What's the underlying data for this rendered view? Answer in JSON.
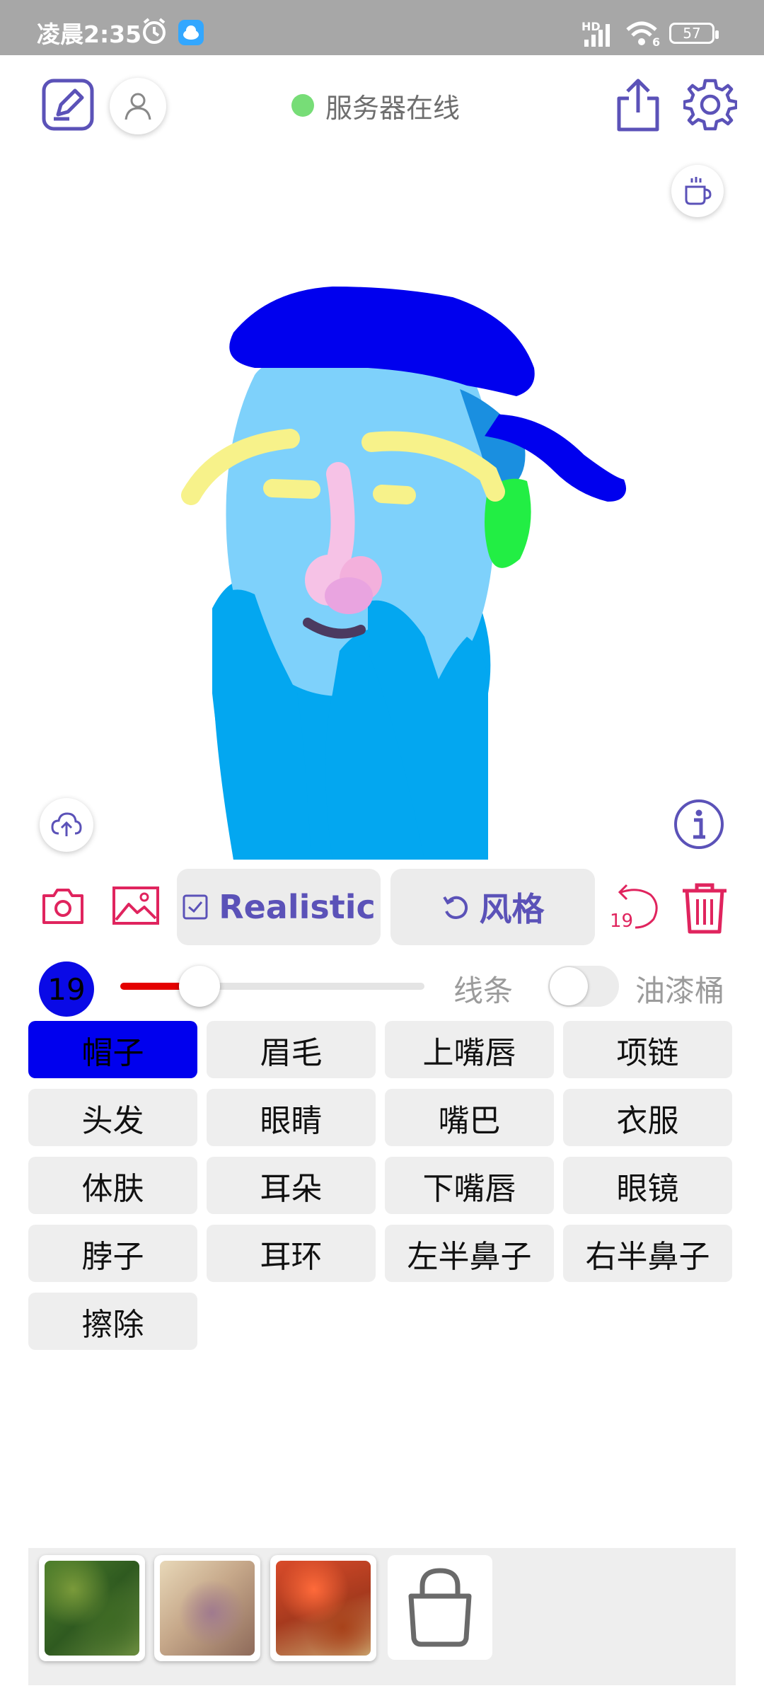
{
  "status_bar": {
    "time": "凌晨2:35",
    "network_label": "HD",
    "signal_sub": "6",
    "battery": "57"
  },
  "header": {
    "server_status": "服务器在线",
    "server_status_color": "#77dd77"
  },
  "toolbar": {
    "style_mode_label": "Realistic",
    "style_button_label": "风格",
    "undo_count": "19",
    "accent_color": "#5b52b8",
    "icon_color": "#e0245e"
  },
  "brush": {
    "size": "19",
    "size_fraction": 0.26,
    "stroke_color": "#0a0ae6",
    "line_label": "线条",
    "bucket_label": "油漆桶",
    "bucket_enabled": false
  },
  "segments": {
    "items": [
      {
        "label": "帽子",
        "selected": true
      },
      {
        "label": "眉毛",
        "selected": false
      },
      {
        "label": "上嘴唇",
        "selected": false
      },
      {
        "label": "项链",
        "selected": false
      },
      {
        "label": "头发",
        "selected": false
      },
      {
        "label": "眼睛",
        "selected": false
      },
      {
        "label": "嘴巴",
        "selected": false
      },
      {
        "label": "衣服",
        "selected": false
      },
      {
        "label": "体肤",
        "selected": false
      },
      {
        "label": "耳朵",
        "selected": false
      },
      {
        "label": "下嘴唇",
        "selected": false
      },
      {
        "label": "眼镜",
        "selected": false
      },
      {
        "label": "脖子",
        "selected": false
      },
      {
        "label": "耳环",
        "selected": false
      },
      {
        "label": "左半鼻子",
        "selected": false
      },
      {
        "label": "右半鼻子",
        "selected": false
      },
      {
        "label": "擦除",
        "selected": false
      }
    ]
  },
  "gallery": {
    "thumbnails": [
      {
        "name": "green-foliage"
      },
      {
        "name": "stone-mosaic"
      },
      {
        "name": "red-flowers"
      }
    ],
    "shop_icon": "shopping-bag-icon"
  }
}
